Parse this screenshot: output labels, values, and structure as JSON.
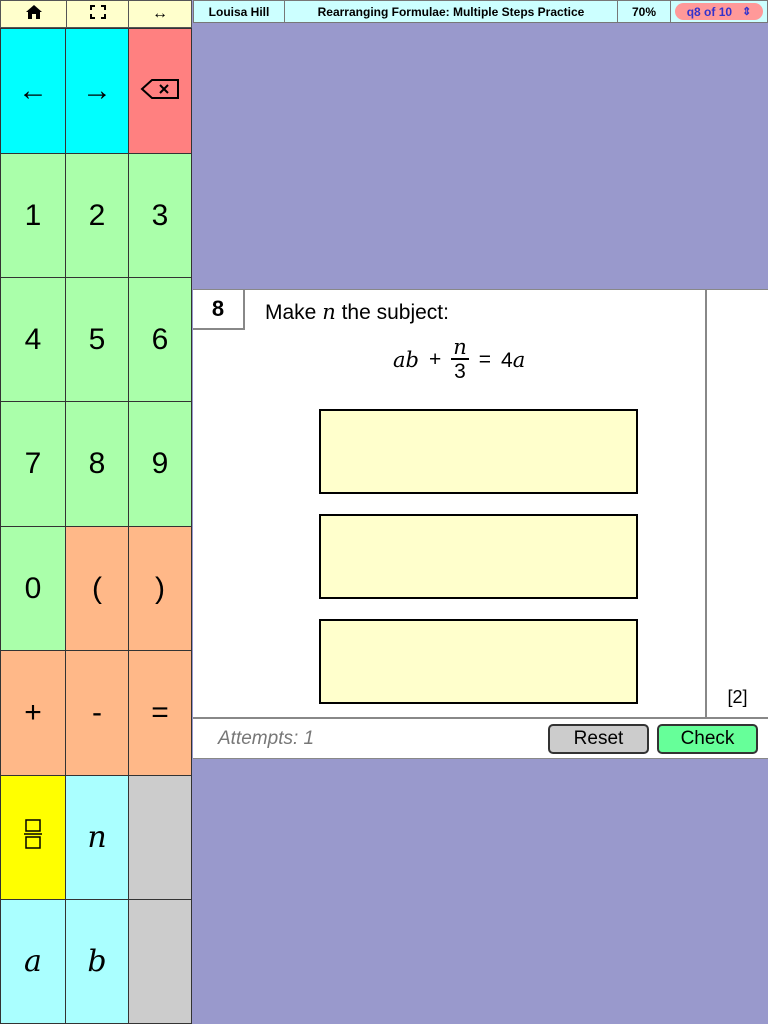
{
  "nav": {
    "home_icon": "home-icon",
    "fullscreen_icon": "fullscreen-icon",
    "resize_icon": "resize-arrows-icon",
    "home_glyph": "⌂",
    "fullscreen_glyph": "⛶",
    "resize_glyph": "↔"
  },
  "header": {
    "student": "Louisa Hill",
    "title": "Rearranging Formulae: Multiple Steps Practice",
    "score": "70%",
    "question_selector": "q8 of 10",
    "selector_glyph": "⇕"
  },
  "keypad": {
    "left_arrow": "←",
    "right_arrow": "→",
    "backspace": "⌫",
    "digits": [
      "1",
      "2",
      "3",
      "4",
      "5",
      "6",
      "7",
      "8",
      "9",
      "0"
    ],
    "open_paren": "(",
    "close_paren": ")",
    "plus": "+",
    "minus": "-",
    "equals": "=",
    "fraction_glyph": "▭",
    "var_n": "n",
    "var_a": "a",
    "var_b": "b"
  },
  "question": {
    "number": "8",
    "prompt_before": "Make",
    "prompt_var": "n",
    "prompt_after": "the subject:",
    "equation": {
      "lhs": "ab",
      "plus": "+",
      "frac_num": "n",
      "frac_den": "3",
      "equals": "=",
      "rhs_coef": "4",
      "rhs_var": "a"
    },
    "answer_boxes": [
      "",
      "",
      ""
    ],
    "marks": "[2]"
  },
  "footer": {
    "attempts": "Attempts: 1",
    "reset_label": "Reset",
    "check_label": "Check"
  },
  "colors": {
    "background": "#9999cc",
    "nav_btn": "#ffffcc",
    "info_bg": "#ccffff",
    "selector_bg": "#ff9999",
    "selector_text": "#3333cc",
    "key_cyan": "#00ffff",
    "key_red": "#ff8080",
    "key_green": "#aaffaa",
    "key_orange": "#ffb888",
    "key_yellow": "#ffff00",
    "key_light_cyan": "#aaffff",
    "key_gray": "#cccccc",
    "answer_box": "#ffffcc",
    "reset_btn": "#cccccc",
    "check_btn": "#66ff99"
  }
}
